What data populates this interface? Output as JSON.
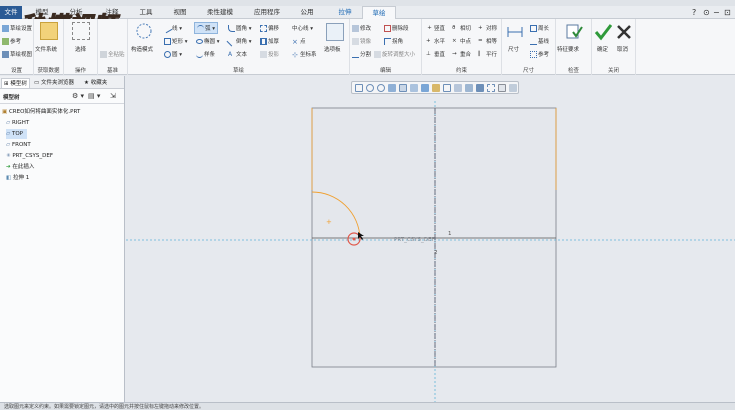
{
  "tabs": [
    {
      "label": "文件",
      "kind": "file"
    },
    {
      "label": "模型"
    },
    {
      "label": "分析"
    },
    {
      "label": "注释"
    },
    {
      "label": "工具"
    },
    {
      "label": "视图"
    },
    {
      "label": "柔性建模"
    },
    {
      "label": "应用程序"
    },
    {
      "label": "公用"
    },
    {
      "label": "拉伸",
      "kind": "context"
    },
    {
      "label": "草绘",
      "kind": "active"
    }
  ],
  "watermark": "秒懂视频",
  "ribbon": {
    "setup": {
      "items": [
        "草绘设置",
        "参考",
        "草绘视图"
      ],
      "label": "设置"
    },
    "data": {
      "items": [
        "文件系统"
      ],
      "label": "获取数据"
    },
    "ops": {
      "items": [
        "选择"
      ],
      "label": "操作"
    },
    "base": {
      "items": [
        "全粘贴"
      ],
      "label": "基准"
    },
    "sketch": {
      "construct": "构造模式",
      "col1": [
        "线",
        "矩形",
        "圆"
      ],
      "col2": [
        "弧",
        "椭圆",
        "样条"
      ],
      "col3": [
        "圆角",
        "倒角",
        "文本"
      ],
      "col4": [
        "偏移",
        "加厚",
        "投影"
      ],
      "col5": [
        "中心线",
        "点",
        "坐标系"
      ],
      "palette": "选项板",
      "label": "草绘"
    },
    "edit": {
      "items": [
        "修改",
        "删除段",
        "镜像",
        "拐角",
        "分割",
        "旋转调整大小"
      ],
      "label": "编辑"
    },
    "constrain": {
      "items": [
        "竖直",
        "相切",
        "对称",
        "水平",
        "中点",
        "相等",
        "垂直",
        "重合",
        "平行"
      ],
      "label": "约束"
    },
    "dimension": {
      "items": [
        "尺寸",
        "周长",
        "基线",
        "参考"
      ],
      "label": "尺寸"
    },
    "inspect": {
      "items": [
        "特征要求"
      ],
      "label": "检查"
    },
    "close": {
      "ok": "确定",
      "cancel": "取消",
      "label": "关闭"
    }
  },
  "left_panel": {
    "tabs": [
      "模型树",
      "文件夹浏览器",
      "收藏夹"
    ],
    "tree_label": "模型树",
    "tree": [
      {
        "text": "CREO如何将曲面实体化.PRT",
        "indent": 0,
        "icon": "part-icon"
      },
      {
        "text": "RIGHT",
        "indent": 1,
        "icon": "plane-icon"
      },
      {
        "text": "TOP",
        "indent": 1,
        "icon": "plane-icon",
        "selected": true
      },
      {
        "text": "FRONT",
        "indent": 1,
        "icon": "plane-icon"
      },
      {
        "text": "PRT_CSYS_DEF",
        "indent": 1,
        "icon": "csys-icon"
      },
      {
        "text": "在此插入",
        "indent": 1,
        "icon": "insert-arrow-icon"
      },
      {
        "text": "拉伸 1",
        "indent": 1,
        "icon": "extrude-icon"
      }
    ]
  },
  "canvas": {
    "csys_label": "PRT_CSYS_DEF",
    "axis_labels": [
      "1",
      "2"
    ]
  },
  "status": {
    "text": "选取图元来定义约束。如果需要锁定图元，请选中的图元并按住鼠标左键拖动来修改位置。"
  },
  "colors": {
    "accent": "#2a5a95",
    "sketch_orange": "#f0a030",
    "selection_red": "#e0584a",
    "dashed_blue": "#5fb3d8"
  }
}
